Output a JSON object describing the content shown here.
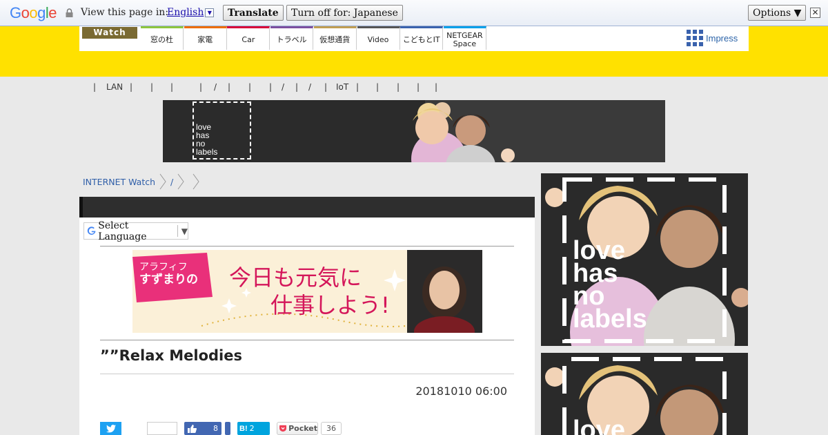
{
  "translate_bar": {
    "view_label": "View this page in:",
    "language": "English",
    "translate_button": "Translate",
    "turn_off_button": "Turn off for: Japanese",
    "options_button": "Options ▼",
    "close_label": "✕"
  },
  "header": {
    "logo_text": "Watch",
    "nav": [
      "窓の杜",
      "家電",
      "Car",
      "トラベル",
      "仮想通貨",
      "Video",
      "こどもとIT",
      "NETGEAR Space"
    ],
    "nav_colors": [
      "#8cc63f",
      "#ed6d00",
      "#d7003a",
      "#7b4fa0",
      "#c09e53",
      "#555555",
      "#3a62ad",
      "#00a0e9"
    ],
    "publisher": "Impress"
  },
  "category_strip": {
    "items": [
      "|",
      "LAN",
      "|",
      "|",
      "|",
      "|",
      "/",
      "|",
      "|",
      "|",
      "/",
      "|",
      "/",
      "|",
      "IoT",
      "|",
      "|",
      "|",
      "|",
      "|"
    ]
  },
  "banner": {
    "tagline_lines": [
      "love",
      "has",
      "no",
      "labels"
    ]
  },
  "breadcrumb": {
    "items": [
      "INTERNET Watch",
      "/"
    ]
  },
  "article": {
    "select_language": "Select Language",
    "ad_small": "アラフィフ",
    "ad_name": "すずまりの",
    "ad_line1": "今日も元気に",
    "ad_line2": "仕事しよう!",
    "title": "””Relax Melodies",
    "date": "20181010 06:00"
  },
  "share": {
    "like_count": "8",
    "hatena_label": "B!",
    "hatena_count": "2",
    "pocket_label": "Pocket",
    "pocket_count": "36"
  },
  "sidebar_ads": {
    "tagline_lines": [
      "love",
      "has",
      "no",
      "labels"
    ],
    "second_tagline": "love"
  }
}
